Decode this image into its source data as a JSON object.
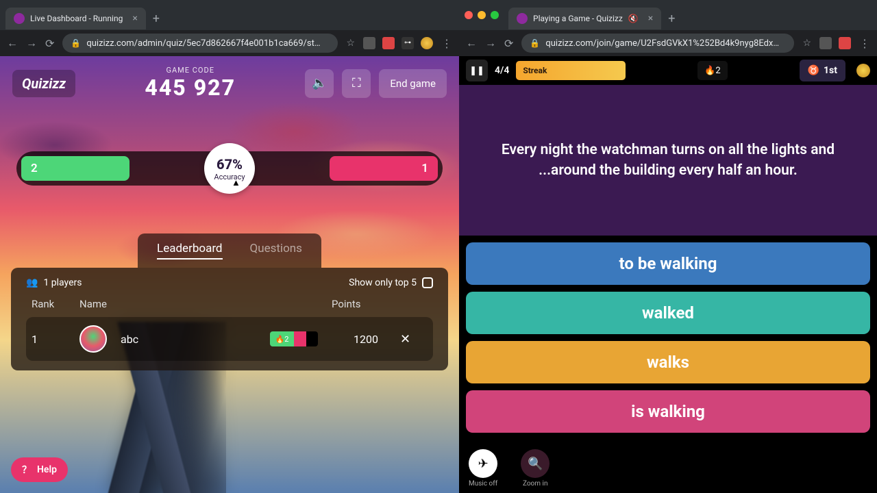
{
  "left": {
    "chrome": {
      "tab_title": "Live Dashboard - Running",
      "url": "quizizz.com/admin/quiz/5ec7d862667f4e001b1ca669/st…"
    },
    "header": {
      "logo": "Quizizz",
      "code_label": "GAME CODE",
      "code_value": "445 927",
      "end_label": "End game"
    },
    "accuracy": {
      "left_count": "2",
      "right_count": "1",
      "percent": "67%",
      "label": "Accuracy"
    },
    "tabs": {
      "leaderboard": "Leaderboard",
      "questions": "Questions"
    },
    "panel": {
      "players": "1 players",
      "show_top": "Show only top 5",
      "cols": {
        "rank": "Rank",
        "name": "Name",
        "points": "Points"
      },
      "row": {
        "rank": "1",
        "name": "abc",
        "streak": "🔥2",
        "points": "1200",
        "remove": "✕"
      }
    },
    "help": "Help"
  },
  "right": {
    "chrome": {
      "tab_title": "Playing a Game - Quizizz",
      "url": "quizizz.com/join/game/U2FsdGVkX1%252Bd4k9nyg8Edx…"
    },
    "top": {
      "q_count": "4/4",
      "streak_label": "Streak",
      "streak_count": "🔥2",
      "rank": "1st"
    },
    "question": "Every night the watchman turns on all the lights and ...around the building every half an hour.",
    "answers": [
      "to be walking",
      "walked",
      "walks",
      "is walking"
    ],
    "bottom": {
      "music": "Music off",
      "zoom": "Zoom in"
    }
  }
}
